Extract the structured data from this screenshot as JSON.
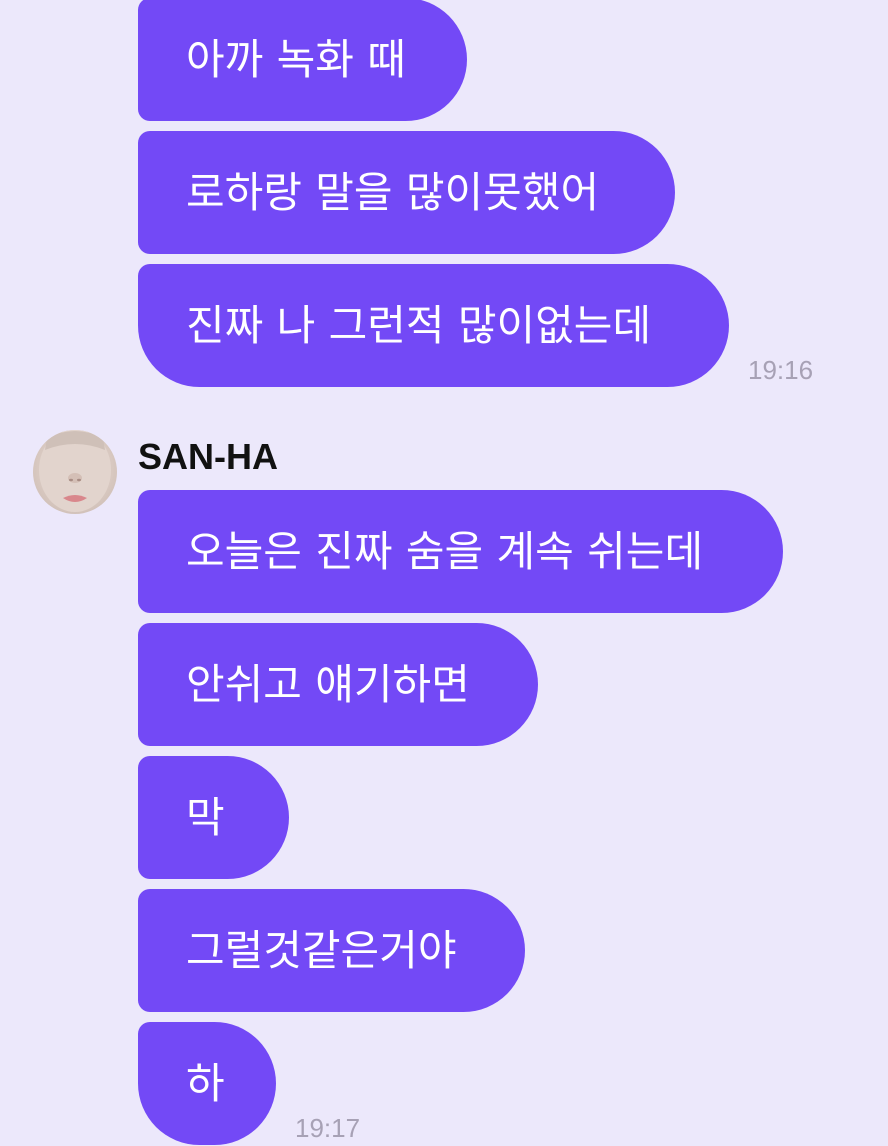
{
  "group1": {
    "messages": [
      "아까 녹화 때",
      "로하랑 말을 많이못했어",
      "진짜 나 그런적 많이없는데"
    ],
    "time": "19:16"
  },
  "group2": {
    "sender": "SAN-HA",
    "avatar_icon": "profile-photo",
    "messages": [
      "오늘은 진짜 숨을 계속 쉬는데",
      "안쉬고 얘기하면",
      "막",
      "그럴것같은거야",
      "하"
    ],
    "time": "19:17"
  },
  "colors": {
    "background": "#ece8fb",
    "bubble": "#7349f6",
    "bubble_text": "#ffffff",
    "timestamp": "#a7a1b5"
  }
}
